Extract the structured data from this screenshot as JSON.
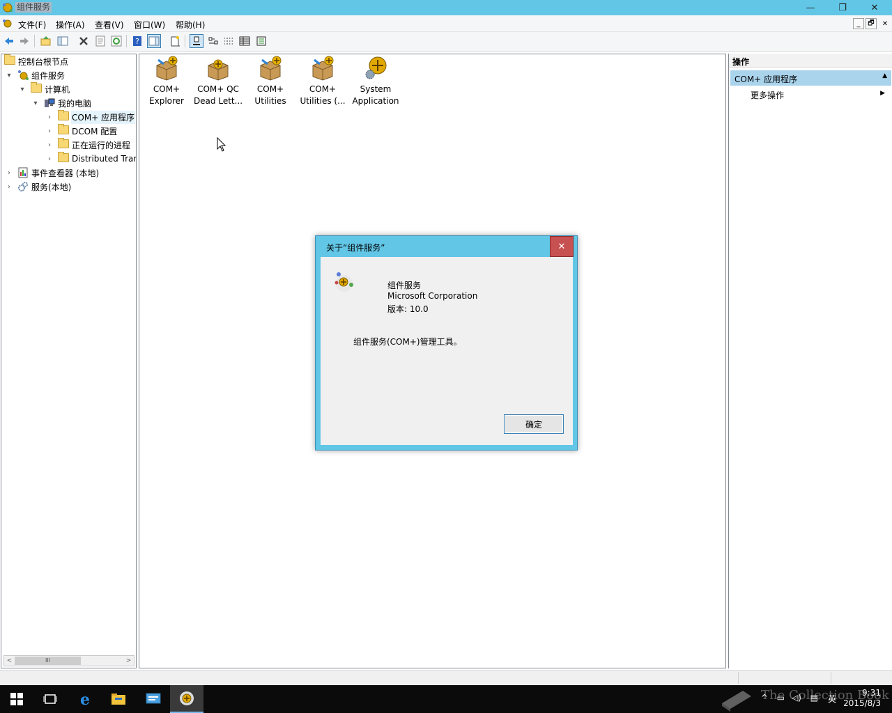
{
  "window": {
    "title": "组件服务",
    "controls": {
      "minimize": "—",
      "restore": "❐",
      "close": "✕"
    }
  },
  "menubar": {
    "items": [
      "文件(F)",
      "操作(A)",
      "查看(V)",
      "窗口(W)",
      "帮助(H)"
    ],
    "mdi_controls": [
      "_",
      "🗗",
      "✕"
    ]
  },
  "toolbar": {
    "buttons": [
      "back-icon",
      "forward-icon",
      "up-icon",
      "show-hide-tree-icon",
      "delete-icon",
      "properties-icon",
      "refresh-icon",
      "help-icon",
      "show-hide-action-pane-icon",
      "export-list-icon",
      "large-icons-view-icon",
      "small-icons-view-icon",
      "list-view-icon",
      "detail-view-icon",
      "status-view-icon"
    ]
  },
  "tree": {
    "items": [
      {
        "label": "控制台根节点",
        "icon": "folder-icon",
        "expander": ""
      },
      {
        "label": "组件服务",
        "icon": "component-services-icon",
        "expander": "▾"
      },
      {
        "label": "计算机",
        "icon": "folder-icon",
        "expander": "▾"
      },
      {
        "label": "我的电脑",
        "icon": "computer-icon",
        "expander": "▾"
      },
      {
        "label": "COM+ 应用程序",
        "icon": "folder-icon",
        "expander": "›"
      },
      {
        "label": "DCOM 配置",
        "icon": "folder-icon",
        "expander": "›"
      },
      {
        "label": "正在运行的进程",
        "icon": "folder-icon",
        "expander": "›"
      },
      {
        "label": "Distributed Tran",
        "icon": "folder-icon",
        "expander": "›"
      },
      {
        "label": "事件查看器 (本地)",
        "icon": "event-viewer-icon",
        "expander": "›"
      },
      {
        "label": "服务(本地)",
        "icon": "services-gear-icon",
        "expander": "›"
      }
    ],
    "scroll_left": "<",
    "scroll_right": ">",
    "scroll_thumb": "III"
  },
  "content": {
    "items": [
      {
        "line1": "COM+",
        "line2": "Explorer",
        "icon": "com-package-icon"
      },
      {
        "line1": "COM+ QC",
        "line2": "Dead Lett...",
        "icon": "com-package-icon"
      },
      {
        "line1": "COM+",
        "line2": "Utilities",
        "icon": "com-package-icon"
      },
      {
        "line1": "COM+",
        "line2": "Utilities (...",
        "icon": "com-package-icon"
      },
      {
        "line1": "System",
        "line2": "Application",
        "icon": "system-application-icon"
      }
    ]
  },
  "actions": {
    "header": "操作",
    "group": "COM+ 应用程序",
    "more": "更多操作"
  },
  "dialog": {
    "title": "关于“组件服务”",
    "close": "✕",
    "product": "组件服务",
    "company": "Microsoft Corporation",
    "version": "版本: 10.0",
    "description": "组件服务(COM+)管理工具。",
    "ok": "确定"
  },
  "taskbar": {
    "apps": [
      "start-icon",
      "task-view-icon",
      "edge-icon",
      "file-explorer-icon",
      "server-manager-icon",
      "component-services-app-icon"
    ],
    "clock_time": "9:31",
    "clock_date": "2015/8/3",
    "ime": "英"
  },
  "watermark": "The Collection Book",
  "colors": {
    "titlebar": "#62c6e6",
    "selection": "#aad3ec",
    "dialog_close": "#c75050",
    "taskbar": "#0b0b0b"
  }
}
